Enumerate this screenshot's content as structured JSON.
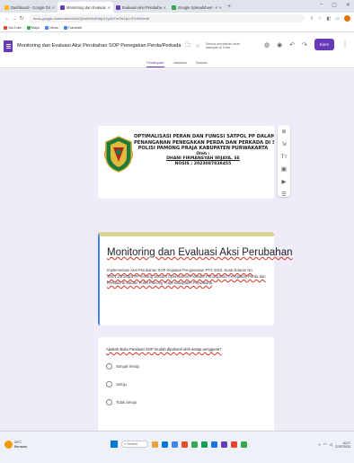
{
  "browser": {
    "tabs": [
      {
        "label": "Dashboard - Google Drive",
        "color": "#fbbc04",
        "active": false
      },
      {
        "label": "Monitoring dan Evaluasi Aksi P...",
        "color": "#673ab7",
        "active": true
      },
      {
        "label": "Evaluasi Aksi Perubahan - Go...",
        "color": "#673ab7",
        "active": false
      },
      {
        "label": "Google Spreadsheet - Analisis...",
        "color": "#34a853",
        "active": false
      }
    ],
    "new_tab": "+",
    "url": "docs.google.com/forms/d/1mQ5u9zWvE8IjL0XyZbTmGk2pLrS7dVN/edit",
    "window_controls": [
      "–",
      "▢",
      "✕"
    ],
    "bookmarks": [
      {
        "label": "YouTube",
        "color": "#ea4335"
      },
      {
        "label": "Maps",
        "color": "#34a853"
      },
      {
        "label": "News",
        "color": "#4285f4"
      },
      {
        "label": "Translate",
        "color": "#4285f4"
      }
    ]
  },
  "form_header": {
    "title": "Monitoring dan Evaluasi Aksi Perubahan SOP Penegakan Perda/Perkada",
    "save_status": "Semua perubahan telah disimpan di Drive",
    "send_label": "Kirim"
  },
  "form_tabs": [
    "Pertanyaan",
    "Jawaban",
    "Setelan"
  ],
  "banner": {
    "line1": "OPTIMALISASI PERAN DAN FUNGSI SATPOL PP DALAM",
    "line2": "PENANGANAN PENEGAKAN PERDA DAN PERKADA DI SATUAN",
    "line3": "POLISI PAMONG PRAJA KABUPATEN PURWAKARTA",
    "by": "Oleh :",
    "name": "DHANI FIRMANSYAH WIJAYA, SE",
    "nosis": "NOSIS : 2023087838455"
  },
  "form": {
    "title": "Monitoring dan Evaluasi Aksi Perubahan",
    "description": "Implementasi Aksi Perubahan SOP Kegiatan Pengawasan PTS 2023. Surat Edaran No. 300/1.23/Satpol PP tentang Standar Operasional Prosedur Penanganan Penegakan Perda dan Perkada di Satuan Polisi Pamong Praja Kabupaten Purwakarta"
  },
  "question": {
    "text": "Apakah Buku Panduan SOP mudah dipahami oleh setiap pengguna?",
    "options": [
      "Sangat Setuju",
      "Setuju",
      "Tidak Setuju"
    ]
  },
  "taskbar": {
    "weather_temp": "24°C",
    "weather_desc": "Berawan",
    "search_label": "Search",
    "apps": [
      "#e8a33c",
      "#0078d4",
      "#4285f4",
      "#e34c26",
      "#34a853",
      "#0f9d58",
      "#1a73e8",
      "#673ab7",
      "#ea4335",
      "#34a853"
    ],
    "time": "10:27",
    "date": "27/07/2023"
  }
}
